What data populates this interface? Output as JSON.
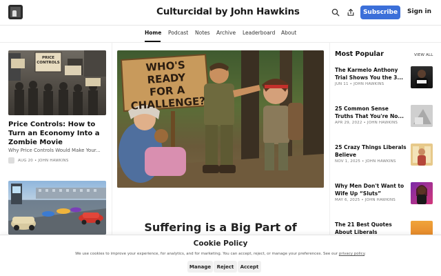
{
  "header": {
    "title": "Culturcidal by John Hawkins",
    "subscribe_label": "Subscribe",
    "signin_label": "Sign in",
    "icons": [
      "search-icon",
      "share-icon"
    ]
  },
  "nav": {
    "items": [
      {
        "label": "Home",
        "active": true
      },
      {
        "label": "Podcast"
      },
      {
        "label": "Notes"
      },
      {
        "label": "Archive"
      },
      {
        "label": "Leaderboard"
      },
      {
        "label": "About"
      }
    ]
  },
  "left_posts": [
    {
      "image_text": "PRICE CONTROLS",
      "title_lines": [
        "Price Controls: How to",
        "Turn an Economy Into a",
        "Zombie Movie"
      ],
      "subtitle": "Why Price Controls Would Make Your...",
      "date": "AUG 20",
      "author": "JOHN HAWKINS"
    },
    {
      "image_text": ""
    }
  ],
  "feature": {
    "image_text_lines": [
      "WHO'S READY",
      "FOR A",
      "CHALLENGE?"
    ],
    "title": "Suffering is a Big Part of"
  },
  "most_popular": {
    "heading": "Most Popular",
    "view_all": "VIEW ALL",
    "items": [
      {
        "title_lines": [
          "The Karmelo Anthony",
          "Trial Shows You the 3..."
        ],
        "date": "JUN 11",
        "author": "JOHN HAWKINS"
      },
      {
        "title_lines": [
          "25 Common Sense",
          "Truths That You're No..."
        ],
        "date": "APR 29, 2022",
        "author": "JOHN HAWKINS"
      },
      {
        "title_lines": [
          "25 Crazy Things Liberals",
          "Believe"
        ],
        "date": "NOV 1, 2025",
        "author": "JOHN HAWKINS"
      },
      {
        "title_lines": [
          "Why Men Don't Want to",
          "Wife Up “Sluts”"
        ],
        "date": "MAY 6, 2025",
        "author": "JOHN HAWKINS"
      },
      {
        "title_lines": [
          "The 21 Best Quotes",
          "About Liberals"
        ],
        "date": "",
        "author": ""
      }
    ]
  },
  "cookie": {
    "title": "Cookie Policy",
    "text_before": "We use cookies to improve your experience, for analytics, and for marketing. You can accept, reject, or manage your preferences. See our ",
    "link": "privacy policy",
    "text_after": ".",
    "manage_label": "Manage",
    "reject_label": "Reject",
    "accept_label": "Accept"
  },
  "colors": {
    "accent": "#3b6fd9",
    "text": "#1a1a1a",
    "muted": "#777777"
  }
}
